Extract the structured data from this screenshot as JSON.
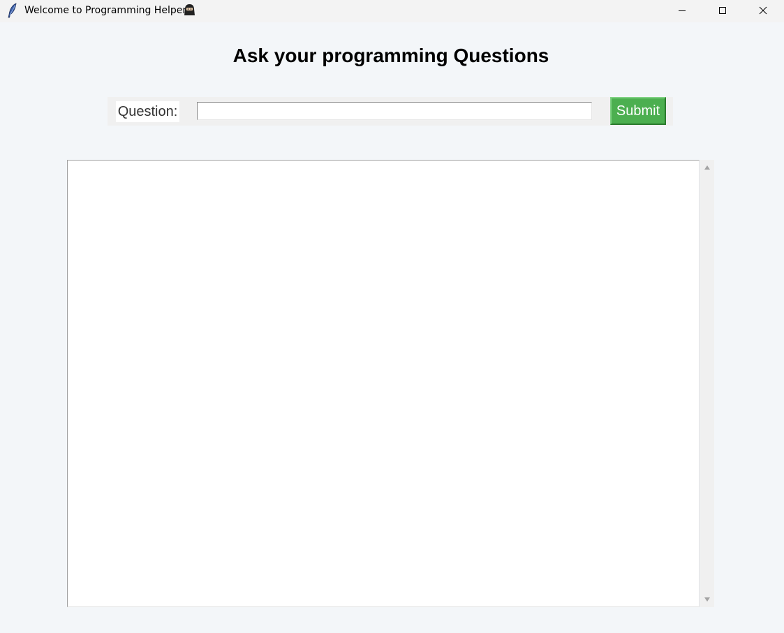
{
  "window": {
    "title": "Welcome to Programming Helper",
    "title_icon": "feather-icon",
    "title_emoji_icon": "ninja-icon",
    "controls": {
      "minimize": "minimize-icon",
      "maximize": "maximize-icon",
      "close": "close-icon"
    }
  },
  "main": {
    "heading": "Ask your programming Questions",
    "question_label": "Question:",
    "question_value": "",
    "submit_label": "Submit",
    "output_text": ""
  },
  "colors": {
    "background": "#f3f6f9",
    "submit_bg": "#4caf50",
    "submit_text": "#ffffff"
  }
}
